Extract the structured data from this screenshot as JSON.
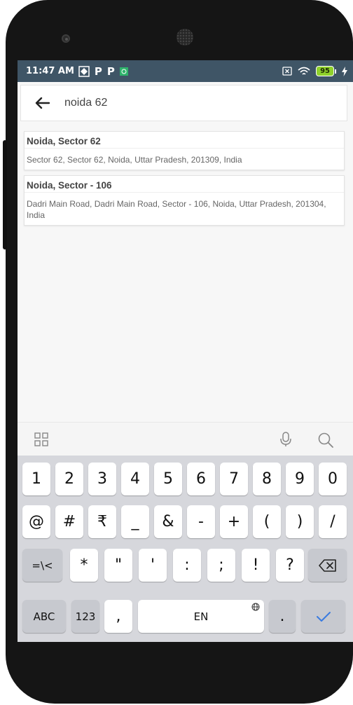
{
  "status": {
    "time": "11:47 AM",
    "left_icons": [
      "nav-icon",
      "p-icon",
      "p-icon",
      "app-icon"
    ],
    "battery": "95",
    "p1": "P",
    "p2": "P"
  },
  "search": {
    "query": "noida 62"
  },
  "results": [
    {
      "title": "Noida, Sector 62",
      "address": "Sector 62, Sector 62, Noida, Uttar Pradesh, 201309, India"
    },
    {
      "title": "Noida, Sector - 106",
      "address": "Dadri Main Road, Dadri Main Road, Sector - 106, Noida, Uttar Pradesh, 201304, India"
    }
  ],
  "keyboard": {
    "row1": [
      "1",
      "2",
      "3",
      "4",
      "5",
      "6",
      "7",
      "8",
      "9",
      "0"
    ],
    "row2": [
      "@",
      "#",
      "₹",
      "_",
      "&",
      "-",
      "+",
      "(",
      ")",
      "/"
    ],
    "row3": [
      "=\\<",
      "*",
      "\"",
      "'",
      ":",
      ";",
      "!",
      "?"
    ],
    "row4": {
      "abc": "ABC",
      "num": "123",
      "comma": ",",
      "space": "EN",
      "period": "."
    }
  },
  "colors": {
    "status_bar": "#3f5566",
    "keyboard_bg": "#d6d7dc",
    "accent": "#3a7be0",
    "battery": "#8fd12b"
  }
}
